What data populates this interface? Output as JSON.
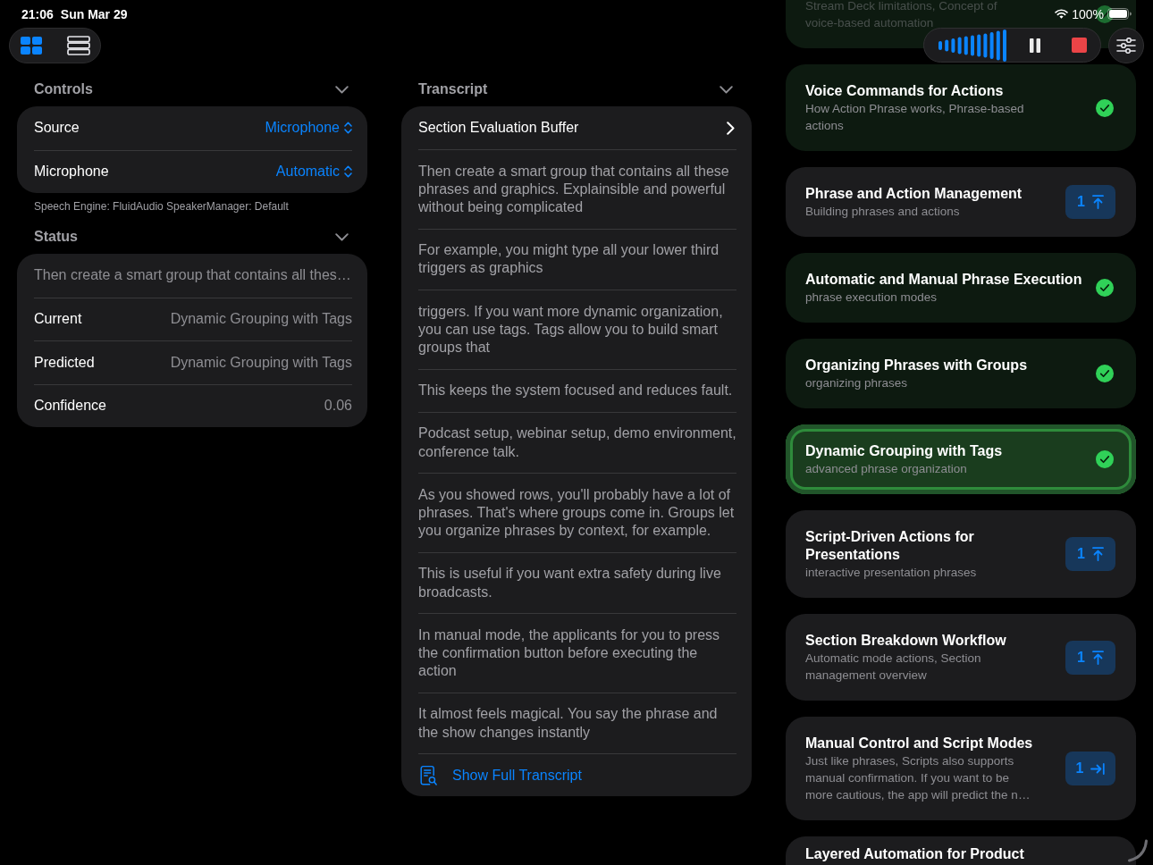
{
  "status_bar": {
    "time": "21:06",
    "date": "Sun Mar 29",
    "battery": "100%"
  },
  "view_modes": [
    {
      "kind": "grid",
      "selected": true
    },
    {
      "kind": "list",
      "selected": false
    }
  ],
  "recorder": {
    "paused": false
  },
  "controls": {
    "title": "Controls",
    "expanded": true,
    "rows": [
      {
        "label": "Source",
        "value": "Microphone",
        "kind": "picker"
      },
      {
        "label": "Microphone",
        "value": "Automatic",
        "kind": "picker"
      }
    ],
    "footnote": "Speech Engine: FluidAudio SpeakerManager: Default"
  },
  "status": {
    "title": "Status",
    "expanded": true,
    "summary": "Then create a smart group that contains all thes…",
    "rows": [
      {
        "label": "Current",
        "value": "Dynamic Grouping with Tags",
        "kind": "info"
      },
      {
        "label": "Predicted",
        "value": "Dynamic Grouping with Tags",
        "kind": "info"
      },
      {
        "label": "Confidence",
        "value": "0.06",
        "kind": "info"
      }
    ]
  },
  "transcript": {
    "title": "Transcript",
    "expanded": true,
    "buffer_link": "Section Evaluation Buffer",
    "segments": [
      "Then create a smart group that contains all these phrases and graphics. Explainsible and powerful without being complicated",
      "For example, you might type all your lower third triggers as graphics",
      "triggers. If you want more dynamic organization, you can use tags. Tags allow you to build smart groups that",
      "This keeps the system focused and reduces fault.",
      "Podcast setup, webinar setup, demo environment, conference talk.",
      "As you showed rows, you'll probably have a lot of phrases. That's where groups come in. Groups let you organize phrases by context, for example.",
      "This is useful if you want extra safety during live broadcasts.",
      "In manual mode, the applicants for you to press the confirmation button before executing the action",
      "It almost feels magical. You say the phrase and the show changes instantly"
    ],
    "show_full_link": "Show Full Transcript"
  },
  "sections": [
    {
      "subtitle": "Stream Deck limitations, Concept of voice-based automation",
      "done": true,
      "selected": false
    },
    {
      "title": "Voice Commands for Actions",
      "subtitle": "How Action Phrase works, Phrase-based actions",
      "done": true,
      "selected": false
    },
    {
      "title": "Phrase and Action Management",
      "subtitle": "Building phrases and actions",
      "done": false,
      "badge": {
        "count": "1",
        "kind": "to_top"
      },
      "selected": false
    },
    {
      "title": "Automatic and Manual Phrase Execution",
      "subtitle": "phrase execution modes",
      "done": true,
      "selected": false
    },
    {
      "title": "Organizing Phrases with Groups",
      "subtitle": "organizing phrases",
      "done": true,
      "selected": false
    },
    {
      "title": "Dynamic Grouping with Tags",
      "subtitle": "advanced phrase organization",
      "done": true,
      "selected": true
    },
    {
      "title": "Script-Driven Actions for Presentations",
      "subtitle": "interactive presentation phrases",
      "done": false,
      "badge": {
        "count": "1",
        "kind": "to_top"
      },
      "selected": false
    },
    {
      "title": "Section Breakdown Workflow",
      "subtitle": "Automatic mode actions, Section management overview",
      "done": false,
      "badge": {
        "count": "1",
        "kind": "to_top"
      },
      "selected": false
    },
    {
      "title": "Manual Control and Script Modes",
      "subtitle": "Just like phrases, Scripts also supports manual confirmation. If you want to be more cautious, the app will predict the n…",
      "done": false,
      "badge": {
        "count": "1",
        "kind": "to_end"
      },
      "selected": false
    },
    {
      "title": "Layered Automation for Product",
      "done": false,
      "selected": false
    }
  ]
}
